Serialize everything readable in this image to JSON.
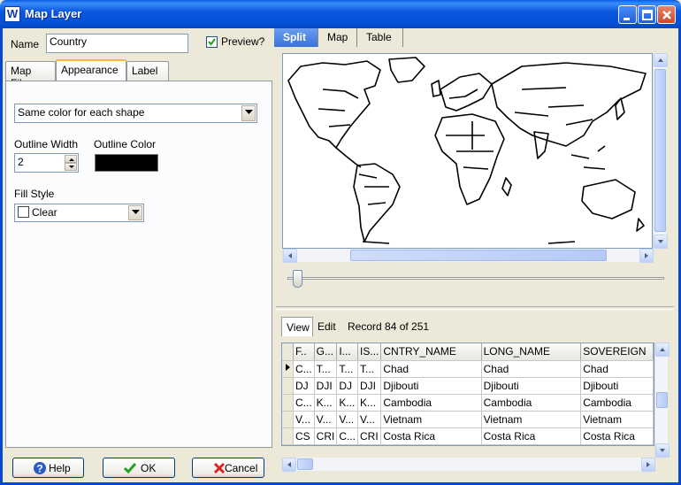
{
  "window": {
    "title": "Map Layer",
    "app_icon_letter": "W"
  },
  "left": {
    "name_label": "Name",
    "name_value": "Country",
    "preview_label": "Preview?",
    "preview_checked": true,
    "tabs": [
      "Map File",
      "Appearance",
      "Label"
    ],
    "active_tab": "Appearance",
    "fill_mode": "Same color for each shape",
    "outline_width_label": "Outline Width",
    "outline_width_value": "2",
    "outline_color_label": "Outline Color",
    "outline_color": "#000000",
    "fill_style_label": "Fill Style",
    "fill_style_value": "Clear"
  },
  "buttons": {
    "help": "Help",
    "ok": "OK",
    "cancel": "Cancel"
  },
  "right": {
    "tabs": [
      "Split",
      "Map",
      "Table"
    ],
    "active_tab": "Split"
  },
  "table": {
    "view_tab": "View",
    "edit_tab": "Edit",
    "record_text": "Record 84 of 251",
    "columns": [
      "F..",
      "G...",
      "I...",
      "IS...",
      "CNTRY_NAME",
      "LONG_NAME",
      "SOVEREIGN"
    ],
    "rows": [
      [
        "C...",
        "T...",
        "T...",
        "T...",
        "Chad",
        "Chad",
        "Chad"
      ],
      [
        "DJ",
        "DJI",
        "DJ",
        "DJI",
        "Djibouti",
        "Djibouti",
        "Djibouti"
      ],
      [
        "C...",
        "K...",
        "K...",
        "K...",
        "Cambodia",
        "Cambodia",
        "Cambodia"
      ],
      [
        "V...",
        "V...",
        "V...",
        "V...",
        "Vietnam",
        "Vietnam",
        "Vietnam"
      ],
      [
        "CS",
        "CRI",
        "C...",
        "CRI",
        "Costa Rica",
        "Costa Rica",
        "Costa Rica"
      ]
    ],
    "current_row": 0
  },
  "colors": {
    "title_bar": "#0a5de6",
    "active_tab": "#3b72d8",
    "accent_tab_border": "#fbb63a"
  }
}
